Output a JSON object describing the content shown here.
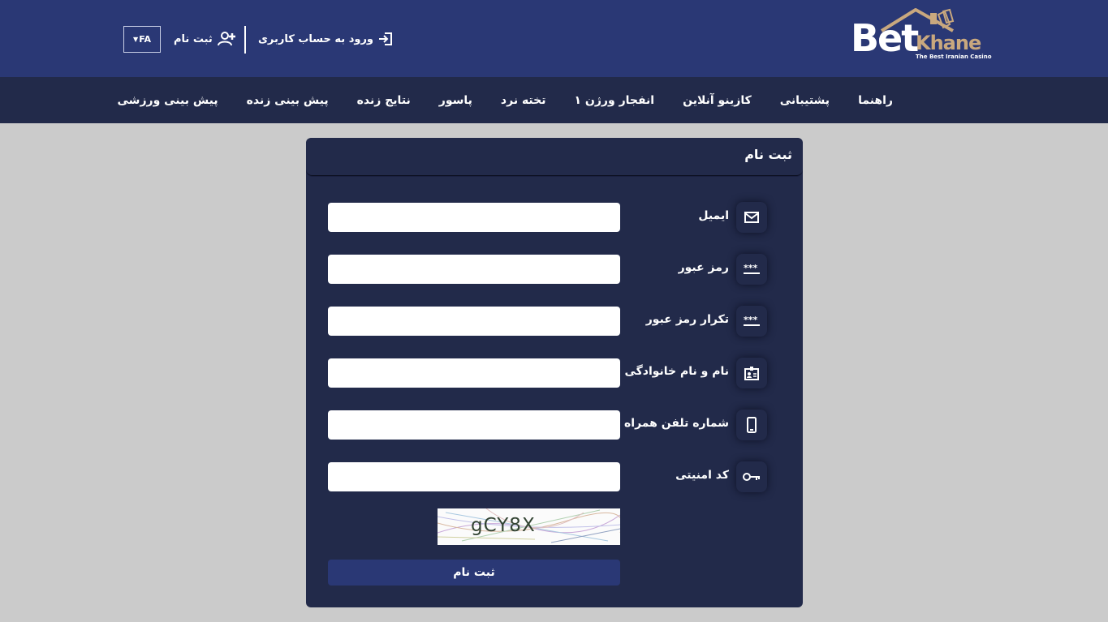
{
  "brand": {
    "name_primary": "Bet",
    "name_secondary": "Khane",
    "tagline": "The Best Iranian Casino",
    "accent_color": "#c9a87e",
    "header_color": "#2a3875",
    "nav_color": "#222a4a"
  },
  "header": {
    "login_label": "ورود به حساب کاربری",
    "login_icon": "login-icon",
    "register_label": "ثبت نام",
    "register_icon": "user-plus-icon",
    "language": "FA"
  },
  "nav": {
    "items": [
      {
        "label": "پیش بینی ورزشی"
      },
      {
        "label": "پیش بینی زنده"
      },
      {
        "label": "نتایج زنده"
      },
      {
        "label": "پاسور"
      },
      {
        "label": "تخته نرد"
      },
      {
        "label": "انفجار ورژن ۱"
      },
      {
        "label": "کازینو آنلاین"
      },
      {
        "label": "پشتیبانی"
      },
      {
        "label": "راهنما"
      }
    ]
  },
  "form": {
    "title": "ثبت نام",
    "fields": [
      {
        "label": "ایمیل",
        "icon": "envelope-icon",
        "value": ""
      },
      {
        "label": "رمز عبور",
        "icon": "password-icon",
        "value": ""
      },
      {
        "label": "تکرار رمز عبور",
        "icon": "password-icon",
        "value": ""
      },
      {
        "label": "نام و نام خانوادگی",
        "icon": "id-card-icon",
        "value": ""
      },
      {
        "label": "شماره تلفن همراه",
        "icon": "mobile-icon",
        "value": ""
      },
      {
        "label": "کد امنیتی",
        "icon": "key-icon",
        "value": ""
      }
    ],
    "captcha_text": "gCY8X",
    "submit_label": "ثبت نام"
  }
}
